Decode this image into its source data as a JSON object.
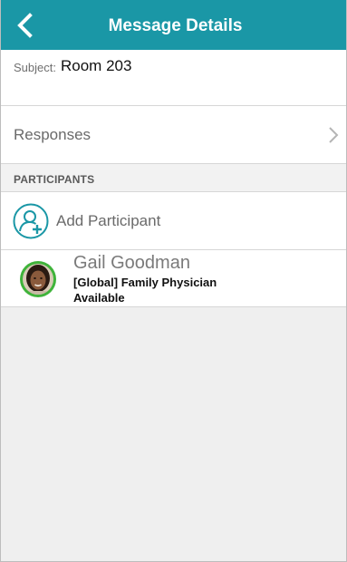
{
  "header": {
    "title": "Message Details",
    "back_icon": "chevron-left-icon",
    "background_color": "#1a97a6"
  },
  "subject": {
    "label": "Subject:",
    "value": "Room 203"
  },
  "responses": {
    "label": "Responses",
    "icon": "chevron-right-icon"
  },
  "participants": {
    "section_label": "PARTICIPANTS",
    "add_label": "Add Participant",
    "add_icon": "add-person-icon",
    "items": [
      {
        "name": "Gail Goodman",
        "role": "[Global] Family Physician",
        "status": "Available",
        "status_color": "#3fb33a"
      }
    ]
  }
}
